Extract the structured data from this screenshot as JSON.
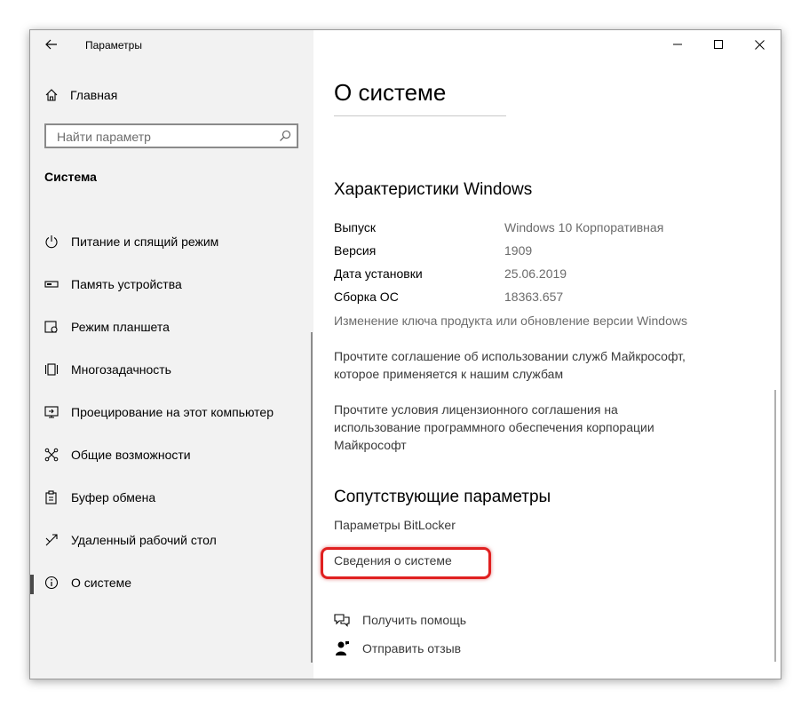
{
  "window": {
    "title": "Параметры"
  },
  "sidebar": {
    "home_label": "Главная",
    "search_placeholder": "Найти параметр",
    "section_title": "Система",
    "items": [
      {
        "icon": "power-icon",
        "label": "Питание и спящий режим"
      },
      {
        "icon": "storage-icon",
        "label": "Память устройства"
      },
      {
        "icon": "tablet-mode-icon",
        "label": "Режим планшета"
      },
      {
        "icon": "multitasking-icon",
        "label": "Многозадачность"
      },
      {
        "icon": "projecting-icon",
        "label": "Проецирование на этот компьютер"
      },
      {
        "icon": "shared-experiences-icon",
        "label": "Общие возможности"
      },
      {
        "icon": "clipboard-icon",
        "label": "Буфер обмена"
      },
      {
        "icon": "remote-desktop-icon",
        "label": "Удаленный рабочий стол"
      },
      {
        "icon": "info-icon",
        "label": "О системе",
        "active": true
      }
    ]
  },
  "main": {
    "title": "О системе",
    "windows_specs": {
      "heading": "Характеристики Windows",
      "rows": [
        {
          "key": "Выпуск",
          "value": "Windows 10 Корпоративная"
        },
        {
          "key": "Версия",
          "value": "1909"
        },
        {
          "key": "Дата установки",
          "value": "25.06.2019"
        },
        {
          "key": "Сборка ОС",
          "value": "18363.657"
        }
      ],
      "change_key_link": "Изменение ключа продукта или обновление версии Windows",
      "services_agreement_link": "Прочтите соглашение об использовании служб Майкрософт, которое применяется к нашим службам",
      "license_terms_link": "Прочтите условия лицензионного соглашения на использование программного обеспечения корпорации Майкрософт"
    },
    "related": {
      "heading": "Сопутствующие параметры",
      "bitlocker_link": "Параметры BitLocker",
      "system_info_link": "Сведения о системе"
    },
    "help": {
      "get_help": "Получить помощь",
      "give_feedback": "Отправить отзыв"
    }
  },
  "colors": {
    "highlight": "#e02020",
    "sidebar_bg": "#f2f2f2"
  }
}
